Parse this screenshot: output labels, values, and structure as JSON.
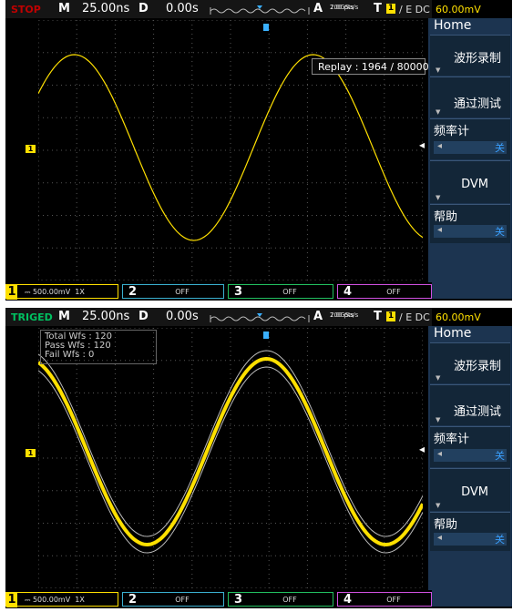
{
  "panels": [
    {
      "status": "STOP",
      "timebase_label": "M",
      "timebase": "25.00ns",
      "delay_label": "D",
      "delay": "0.00s",
      "acq_mode": "A",
      "points": "700 pts",
      "sample_rate": "2.0GSa/s",
      "trigger_label": "T",
      "trigger_source": "1",
      "trigger_info": "/ E DC",
      "trigger_level": "60.00mV",
      "overlay": {
        "type": "replay",
        "text": "Replay :   1964  / 80000"
      },
      "menu": {
        "title": "Home",
        "items": [
          {
            "label": "波形录制"
          },
          {
            "label": "通过测试"
          },
          {
            "label": "频率计",
            "sub_value": "关"
          },
          {
            "label": "DVM"
          },
          {
            "label": "帮助",
            "sub_value": "关"
          }
        ]
      },
      "channels": [
        {
          "num": "1",
          "value": "500.00mV",
          "probe": "1X"
        },
        {
          "num": "2",
          "value": "OFF"
        },
        {
          "num": "3",
          "value": "OFF"
        },
        {
          "num": "4",
          "value": "OFF"
        }
      ],
      "channel_marker": "1",
      "trace_color": "#ffe000"
    },
    {
      "status": "TRIGED",
      "timebase_label": "M",
      "timebase": "25.00ns",
      "delay_label": "D",
      "delay": "0.00s",
      "acq_mode": "A",
      "points": "700 pts",
      "sample_rate": "2.0GSa/s",
      "trigger_label": "T",
      "trigger_source": "1",
      "trigger_info": "/ E DC",
      "trigger_level": "60.00mV",
      "overlay": {
        "type": "stats",
        "lines": [
          "Total Wfs : 120",
          "Pass Wfs : 120",
          "Fail Wfs : 0"
        ]
      },
      "menu": {
        "title": "Home",
        "items": [
          {
            "label": "波形录制"
          },
          {
            "label": "通过测试"
          },
          {
            "label": "频率计",
            "sub_value": "关"
          },
          {
            "label": "DVM"
          },
          {
            "label": "帮助",
            "sub_value": "关"
          }
        ]
      },
      "channels": [
        {
          "num": "1",
          "value": "500.00mV",
          "probe": "1X"
        },
        {
          "num": "2",
          "value": "OFF"
        },
        {
          "num": "3",
          "value": "OFF"
        },
        {
          "num": "4",
          "value": "OFF"
        }
      ],
      "channel_marker": "1",
      "trace_color": "#ffe000"
    }
  ]
}
